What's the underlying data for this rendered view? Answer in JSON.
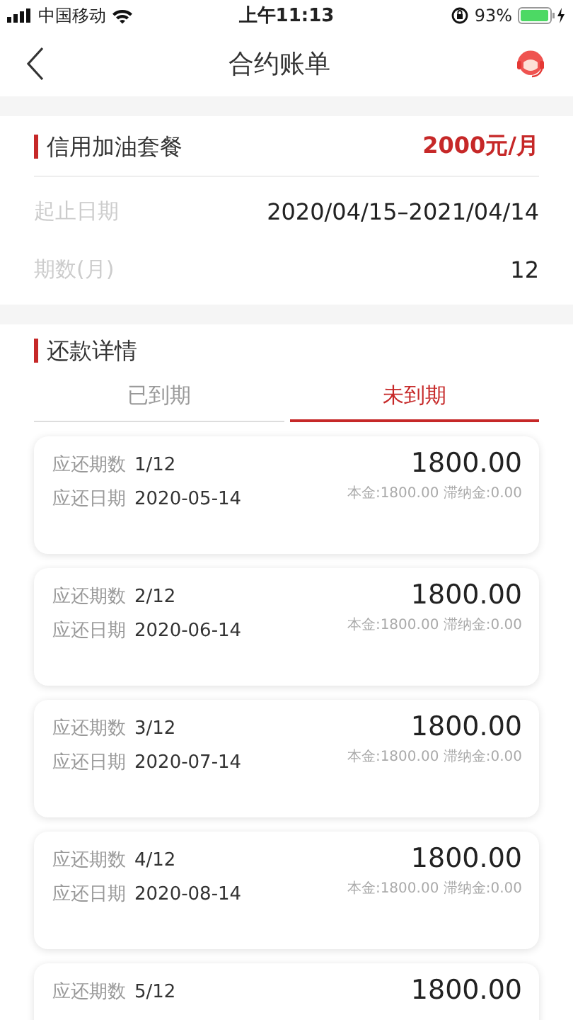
{
  "status_bar": {
    "carrier": "中国移动",
    "time": "上午11:13",
    "battery": "93%"
  },
  "nav": {
    "title": "合约账单"
  },
  "plan": {
    "name": "信用加油套餐",
    "price": "2000元/月",
    "rows": [
      {
        "label": "起止日期",
        "value": "2020/04/15–2021/04/14"
      },
      {
        "label": "期数(月)",
        "value": "12"
      }
    ]
  },
  "repayment": {
    "title": "还款详情",
    "tabs": [
      {
        "label": "已到期",
        "selected": false
      },
      {
        "label": "未到期",
        "selected": true
      }
    ],
    "items": [
      {
        "period_label": "应还期数",
        "period": "1/12",
        "date_label": "应还日期",
        "date": "2020-05-14",
        "amount": "1800.00",
        "breakdown": "本金:1800.00 滞纳金:0.00"
      },
      {
        "period_label": "应还期数",
        "period": "2/12",
        "date_label": "应还日期",
        "date": "2020-06-14",
        "amount": "1800.00",
        "breakdown": "本金:1800.00 滞纳金:0.00"
      },
      {
        "period_label": "应还期数",
        "period": "3/12",
        "date_label": "应还日期",
        "date": "2020-07-14",
        "amount": "1800.00",
        "breakdown": "本金:1800.00 滞纳金:0.00"
      },
      {
        "period_label": "应还期数",
        "period": "4/12",
        "date_label": "应还日期",
        "date": "2020-08-14",
        "amount": "1800.00",
        "breakdown": "本金:1800.00 滞纳金:0.00"
      },
      {
        "period_label": "应还期数",
        "period": "5/12",
        "amount": "1800.00"
      }
    ]
  }
}
